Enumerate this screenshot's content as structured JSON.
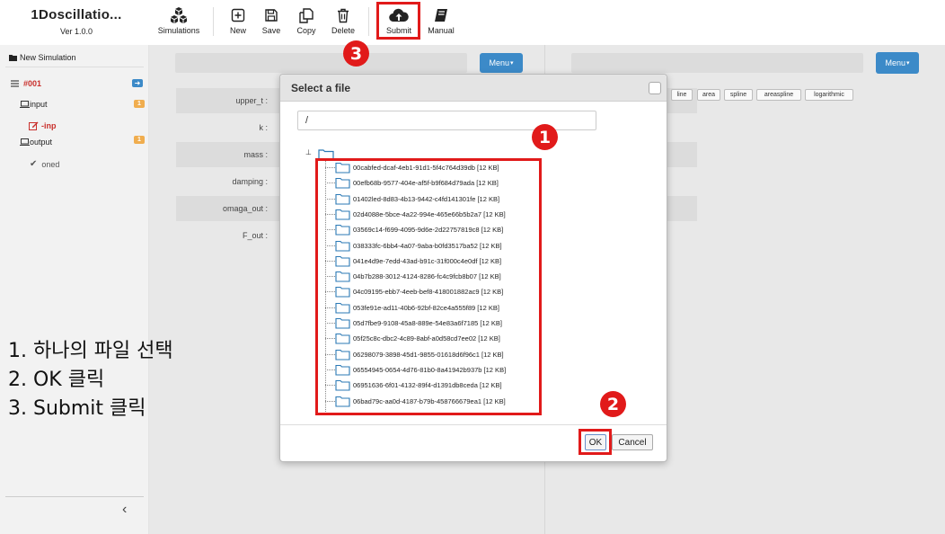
{
  "app": {
    "title": "1Doscillatio...",
    "version": "Ver 1.0.0"
  },
  "toolbar": {
    "simulations": "Simulations",
    "new": "New",
    "save": "Save",
    "copy": "Copy",
    "delete": "Delete",
    "submit": "Submit",
    "manual": "Manual"
  },
  "sidebar": {
    "new_simulation": "New Simulation",
    "sim_id": "#001",
    "input": "input",
    "input_badge": "1",
    "inp_item": "-inp",
    "output": "output",
    "output_badge": "1",
    "oned": "oned",
    "collapse": "‹"
  },
  "main": {
    "menu_label": "Menu",
    "params": [
      "upper_t :",
      "k :",
      "mass :",
      "damping :",
      "omaga_out :",
      "F_out :"
    ],
    "chart_types": [
      "line",
      "area",
      "spline",
      "areaspline",
      "logarithmic"
    ]
  },
  "instructions": [
    "1. 하나의 파일 선택",
    "2. OK 클릭",
    "3. Submit 클릭"
  ],
  "dialog": {
    "title": "Select a file",
    "path": "/",
    "files": [
      "00cabfed-dcaf-4eb1-91d1-5f4c764d39db [12 KB]",
      "00efb68b-9577-404e-af5f-b9f684d79ada [12 KB]",
      "01402led-8d83-4b13-9442-c4fd141301fe [12 KB]",
      "02d4088e-5bce-4a22-994e-465e66b5b2a7 [12 KB]",
      "03569c14-f699-4095-9d6e-2d22757819c8 [12 KB]",
      "038333fc-6bb4-4a07-9aba-b0fd3517ba52 [12 KB]",
      "041e4d9e-7edd-43ad-b91c-31f000c4e0df [12 KB]",
      "04b7b288-3012-4124-8286-fc4c9fcb8b07 [12 KB]",
      "04c09195-ebb7-4eeb-bef8-418001882ac9 [12 KB]",
      "053fe91e-ad11-40b6-92bf-82ce4a555f89 [12 KB]",
      "05d7fbe9-9108-45a8-889e-54e83a6f7185 [12 KB]",
      "05f25c8c-dbc2-4c89-8abf-a0d58cd7ee02 [12 KB]",
      "06298079-3898-45d1-9855-01618d6f96c1 [12 KB]",
      "06554945-0654-4d76-81b0-8a41942b937b [12 KB]",
      "06951636-6f01-4132-89f4-d1391db8ceda [12 KB]",
      "06bad79c-aa0d-4187-b79b-458766679ea1 [12 KB]"
    ],
    "ok": "OK",
    "cancel": "Cancel"
  },
  "annotations": {
    "one": "1",
    "two": "2",
    "three": "3"
  },
  "colors": {
    "accent": "#3c8ac8",
    "annotation_red": "#e11a1a",
    "badge_orange": "#f0ad4e",
    "sim_red": "#c9302c"
  }
}
